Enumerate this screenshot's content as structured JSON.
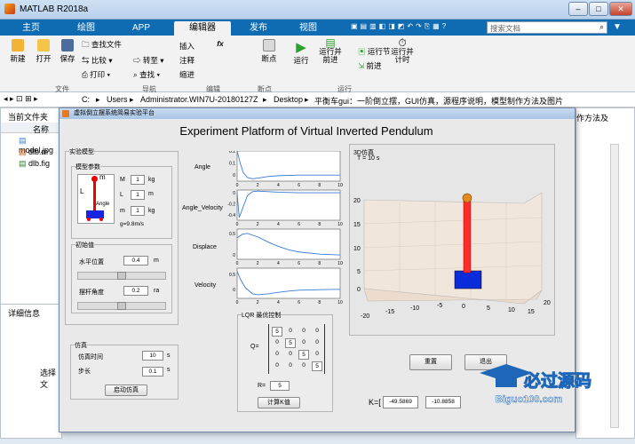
{
  "window": {
    "title": "MATLAB R2018a",
    "search_placeholder": "搜索文档"
  },
  "tabs": [
    "主页",
    "绘图",
    "APP",
    "编辑器",
    "发布",
    "视图"
  ],
  "toolbar": {
    "new": "新建",
    "open": "打开",
    "save": "保存",
    "find_files": "查找文件",
    "compare": "比较",
    "print": "打印",
    "goto": "转至",
    "find": "查找",
    "insert": "插入",
    "comment": "注释",
    "indent": "缩进",
    "fx": "fx",
    "breakpoints": "断点",
    "run": "运行",
    "run_advance": "运行并\n前进",
    "run_section": "运行节",
    "advance": "前进",
    "run_time": "运行并\n计时",
    "groups": [
      "文件",
      "导航",
      "编辑",
      "断点",
      "运行"
    ]
  },
  "path": [
    "C:",
    "Users",
    "Administrator.WIN7U-20180127Z",
    "Desktop",
    "平衡车gui：一阶倒立摆，GUI仿真，源程序说明，模型制作方法及图片"
  ],
  "left": {
    "current_folder": "当前文件夹",
    "name_col": "名称",
    "files": [
      "model.jpg",
      "dlb.m",
      "dlb.fig"
    ],
    "details": "详细信息",
    "select_hint": "选择文"
  },
  "right_overflow": "作方法及",
  "fig": {
    "title": "虚拟倒立摆系统简易实验平台",
    "heading": "Experiment Platform of Virtual Inverted Pendulum",
    "model_panel": "实验模型",
    "params_panel": "模型参数",
    "M_label": "M",
    "M_value": "1",
    "M_unit": "kg",
    "L_label": "L",
    "L_value": "1",
    "L_unit": "m",
    "m_label": "m",
    "m_value": "1",
    "m_unit": "kg",
    "g_label": "g=9.8m/s",
    "diagram_m": "m",
    "diagram_L": "L",
    "diagram_angle": "Angle",
    "init_panel": "初始值",
    "hpos_label": "水平位置",
    "hpos_value": "0.4",
    "hpos_unit": "m",
    "angle_label": "摆杆角度",
    "angle_value": "0.2",
    "angle_unit": "ra",
    "sim_panel": "仿真",
    "simtime_label": "仿真时间",
    "simtime_value": "10",
    "simtime_unit": "s",
    "step_label": "步长",
    "step_value": "0.1",
    "step_unit": "s",
    "start_btn": "启动仿真",
    "plots": [
      "Angle",
      "Angle_Velocity",
      "Displace",
      "Velocity"
    ],
    "lqr_panel": "LQR 最优控制",
    "Q_label": "Q=",
    "Q": [
      [
        "5",
        "0",
        "0",
        "0"
      ],
      [
        "0",
        "5",
        "0",
        "0"
      ],
      [
        "0",
        "0",
        "5",
        "0"
      ],
      [
        "0",
        "0",
        "0",
        "5"
      ]
    ],
    "R_label": "R=",
    "R_value": "5",
    "calc_btn": "计算K值",
    "view3d": "3D仿真",
    "time_label": "T = 10 s",
    "reset_btn": "重置",
    "exit_btn": "退出",
    "K_label": "K=[",
    "K_values": [
      "-49.5869",
      "-10.8858"
    ]
  },
  "watermark": {
    "brand": "必过源码",
    "url": "Biguo100.com"
  },
  "chart_data": [
    {
      "type": "line",
      "title": "Angle",
      "x_ticks": [
        "0",
        "2",
        "4",
        "6",
        "8",
        "10"
      ],
      "y_ticks": [
        "0",
        "0.1",
        "0.2"
      ],
      "ylim": [
        -0.05,
        0.2
      ],
      "x": [
        0,
        0.3,
        0.6,
        1,
        1.5,
        2,
        3,
        4,
        6,
        8,
        10
      ],
      "y": [
        0.2,
        0.1,
        0.02,
        -0.02,
        -0.03,
        -0.025,
        -0.012,
        -0.005,
        0,
        0,
        0
      ]
    },
    {
      "type": "line",
      "title": "Angle_Velocity",
      "x_ticks": [
        "0",
        "2",
        "4",
        "6",
        "8",
        "10"
      ],
      "y_ticks": [
        "0",
        "-0.2",
        "-0.4"
      ],
      "ylim": [
        -0.5,
        0.05
      ],
      "x": [
        0,
        0.2,
        0.5,
        1,
        1.5,
        2,
        3,
        4,
        6,
        8,
        10
      ],
      "y": [
        0,
        -0.45,
        -0.3,
        -0.05,
        0.02,
        0.03,
        0.02,
        0.01,
        0,
        0,
        0
      ]
    },
    {
      "type": "line",
      "title": "Displace",
      "x_ticks": [
        "0",
        "2",
        "4",
        "6",
        "8",
        "10"
      ],
      "y_ticks": [
        "0",
        "0.5"
      ],
      "ylim": [
        -0.1,
        0.6
      ],
      "x": [
        0,
        0.5,
        1,
        2,
        3,
        4,
        5,
        6,
        8,
        10
      ],
      "y": [
        0.4,
        0.48,
        0.5,
        0.42,
        0.3,
        0.2,
        0.12,
        0.07,
        0.02,
        0
      ]
    },
    {
      "type": "line",
      "title": "Velocity",
      "x_ticks": [
        "0",
        "2",
        "4",
        "6",
        "8",
        "10"
      ],
      "y_ticks": [
        "0",
        "0.5"
      ],
      "ylim": [
        -0.3,
        0.7
      ],
      "x": [
        0,
        0.3,
        0.8,
        1.5,
        2,
        3,
        4,
        5,
        6,
        8,
        10
      ],
      "y": [
        0.6,
        0.35,
        0.05,
        -0.15,
        -0.18,
        -0.15,
        -0.1,
        -0.06,
        -0.03,
        -0.01,
        0
      ]
    }
  ],
  "colors": {
    "tabbar": "#0f6cb3",
    "line": "#3a7bd5",
    "pole": "#ff2a2a",
    "cart": "#0a2bd9",
    "floor": "#f1e6dc"
  }
}
